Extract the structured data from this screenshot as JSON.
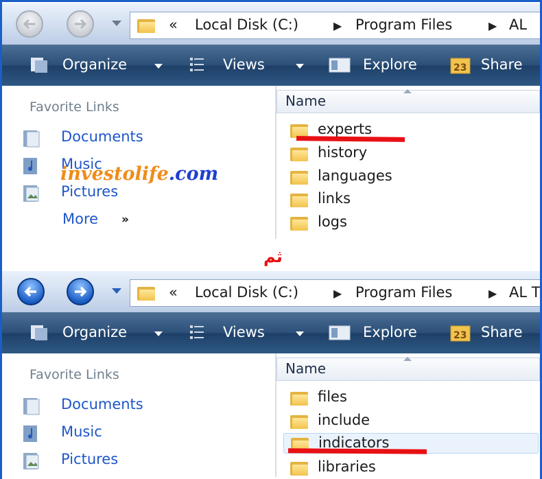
{
  "colors": {
    "window_border": "#1a5fc8",
    "toolbar": "#2b4f78",
    "link_blue": "#1e56c8",
    "annotation_red": "#e81014",
    "watermark_orange": "#f08c1a",
    "watermark_blue": "#1e3fd0"
  },
  "watermark": {
    "part1": "inves",
    "part2": "to",
    "part3": "life",
    "part4": ".com"
  },
  "annotation_text": "ثم",
  "panel1": {
    "nav": {
      "back_enabled": false,
      "forward_enabled": false
    },
    "address": {
      "prefix": "«",
      "crumbs": [
        "Local Disk (C:)",
        "Program Files",
        "AL"
      ]
    },
    "toolbar": {
      "organize": "Organize",
      "views": "Views",
      "explore": "Explore",
      "share": "Share"
    },
    "favorites": {
      "title": "Favorite Links",
      "items": [
        "Documents",
        "Music",
        "Pictures"
      ],
      "more": "More",
      "more_arrows": "»"
    },
    "column_header": "Name",
    "files": [
      "experts",
      "history",
      "languages",
      "links",
      "logs"
    ]
  },
  "panel2": {
    "nav": {
      "back_enabled": true,
      "forward_enabled": true
    },
    "address": {
      "prefix": "«",
      "crumbs": [
        "Local Disk (C:)",
        "Program Files",
        "AL T"
      ]
    },
    "toolbar": {
      "organize": "Organize",
      "views": "Views",
      "explore": "Explore",
      "share": "Share"
    },
    "favorites": {
      "title": "Favorite Links",
      "items": [
        "Documents",
        "Music",
        "Pictures"
      ]
    },
    "column_header": "Name",
    "files": [
      "files",
      "include",
      "indicators",
      "libraries"
    ],
    "selected_file": "indicators"
  }
}
